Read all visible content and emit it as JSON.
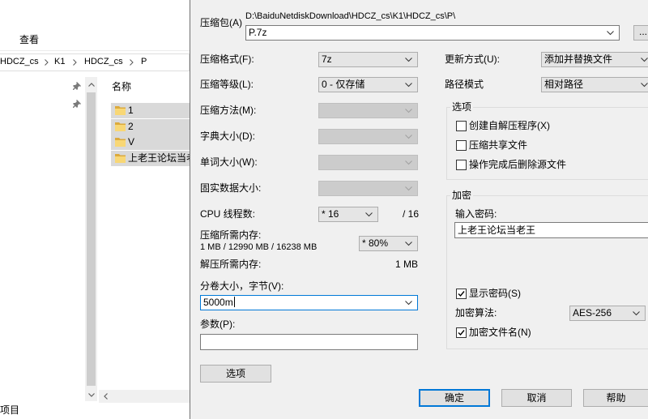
{
  "theme": {
    "accent": "#0078d7",
    "selection": "#d9d9d9",
    "dialog_bg": "#f0f0f0"
  },
  "explorer": {
    "ribbon_tab": "查看",
    "breadcrumb": [
      "HDCZ_cs",
      "K1",
      "HDCZ_cs",
      "P"
    ],
    "column_name": "名称",
    "files": [
      "1",
      "2",
      "V",
      "上老王论坛当老"
    ],
    "status_text": "项目",
    "icons": {
      "folder": "folder-icon",
      "pin": "pin-icon",
      "separator": "chevron-right-icon"
    }
  },
  "dialog": {
    "archive": {
      "label": "压缩包(A)",
      "directory": "D:\\BaiduNetdiskDownload\\HDCZ_cs\\K1\\HDCZ_cs\\P\\",
      "name": "P.7z",
      "browse_label": "..."
    },
    "format": {
      "label": "压缩格式(F):",
      "value": "7z"
    },
    "level": {
      "label": "压缩等级(L):",
      "value": "0 - 仅存储"
    },
    "method": {
      "label": "压缩方法(M):",
      "enabled": false
    },
    "dictionary": {
      "label": "字典大小(D):",
      "enabled": false
    },
    "word_size": {
      "label": "单词大小(W):",
      "enabled": false
    },
    "solid_size": {
      "label": "固实数据大小:",
      "enabled": false
    },
    "threads": {
      "label": "CPU 线程数:",
      "value": "* 16",
      "max": "/ 16"
    },
    "compress_memory": {
      "label": "压缩所需内存:",
      "detail": "1 MB / 12990 MB / 16238 MB",
      "value": "* 80%"
    },
    "decompress_memory": {
      "label": "解压所需内存:",
      "value": "1 MB"
    },
    "volume": {
      "label": "分卷大小，字节(V):",
      "value": "5000m"
    },
    "parameters": {
      "label": "参数(P):"
    },
    "options_button": "选项",
    "update_mode": {
      "label": "更新方式(U):",
      "value": "添加并替换文件"
    },
    "path_mode": {
      "label": "路径模式",
      "value": "相对路径"
    },
    "options_group": {
      "title": "选项",
      "items": [
        {
          "label": "创建自解压程序(X)",
          "checked": false
        },
        {
          "label": "压缩共享文件",
          "checked": false
        },
        {
          "label": "操作完成后删除源文件",
          "checked": false
        }
      ]
    },
    "encryption": {
      "title": "加密",
      "password_label": "输入密码:",
      "password_value": "上老王论坛当老王",
      "show_password": {
        "label": "显示密码(S)",
        "checked": true
      },
      "method_label": "加密算法:",
      "method_value": "AES-256",
      "encrypt_names": {
        "label": "加密文件名(N)",
        "checked": true
      }
    },
    "buttons": {
      "ok": "确定",
      "cancel": "取消",
      "help": "帮助"
    }
  }
}
